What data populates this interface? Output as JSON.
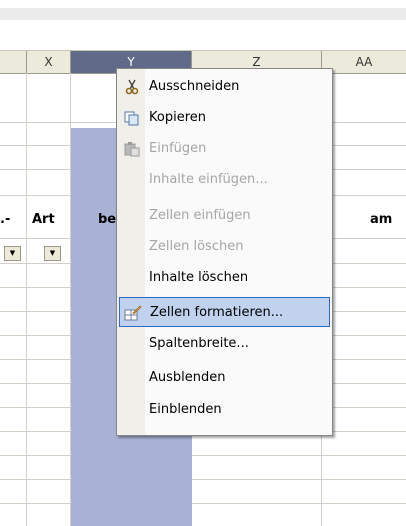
{
  "columns": [
    "X",
    "Y",
    "Z",
    "AA"
  ],
  "header_row": {
    "cells": [
      ".-",
      "Art",
      "be",
      "am"
    ]
  },
  "context_menu": {
    "items": [
      {
        "label": "Ausschneiden",
        "icon": "scissors-icon",
        "enabled": true
      },
      {
        "label": "Kopieren",
        "icon": "copy-icon",
        "enabled": true
      },
      {
        "label": "Einfügen",
        "icon": "paste-icon",
        "enabled": false
      },
      {
        "label": "Inhalte einfügen...",
        "enabled": false
      },
      {
        "label": "Zellen einfügen",
        "enabled": false
      },
      {
        "label": "Zellen löschen",
        "enabled": false
      },
      {
        "label": "Inhalte löschen",
        "enabled": true
      },
      {
        "label": "Zellen formatieren...",
        "icon": "format-cells-icon",
        "enabled": true,
        "highlighted": true
      },
      {
        "label": "Spaltenbreite...",
        "enabled": true
      },
      {
        "label": "Ausblenden",
        "enabled": true
      },
      {
        "label": "Einblenden",
        "enabled": true
      }
    ]
  },
  "colors": {
    "selected_header": "#5f6b88",
    "selected_column": "#a9b1d4",
    "menu_highlight": "#c1d2ee",
    "menu_highlight_border": "#316ac5"
  }
}
